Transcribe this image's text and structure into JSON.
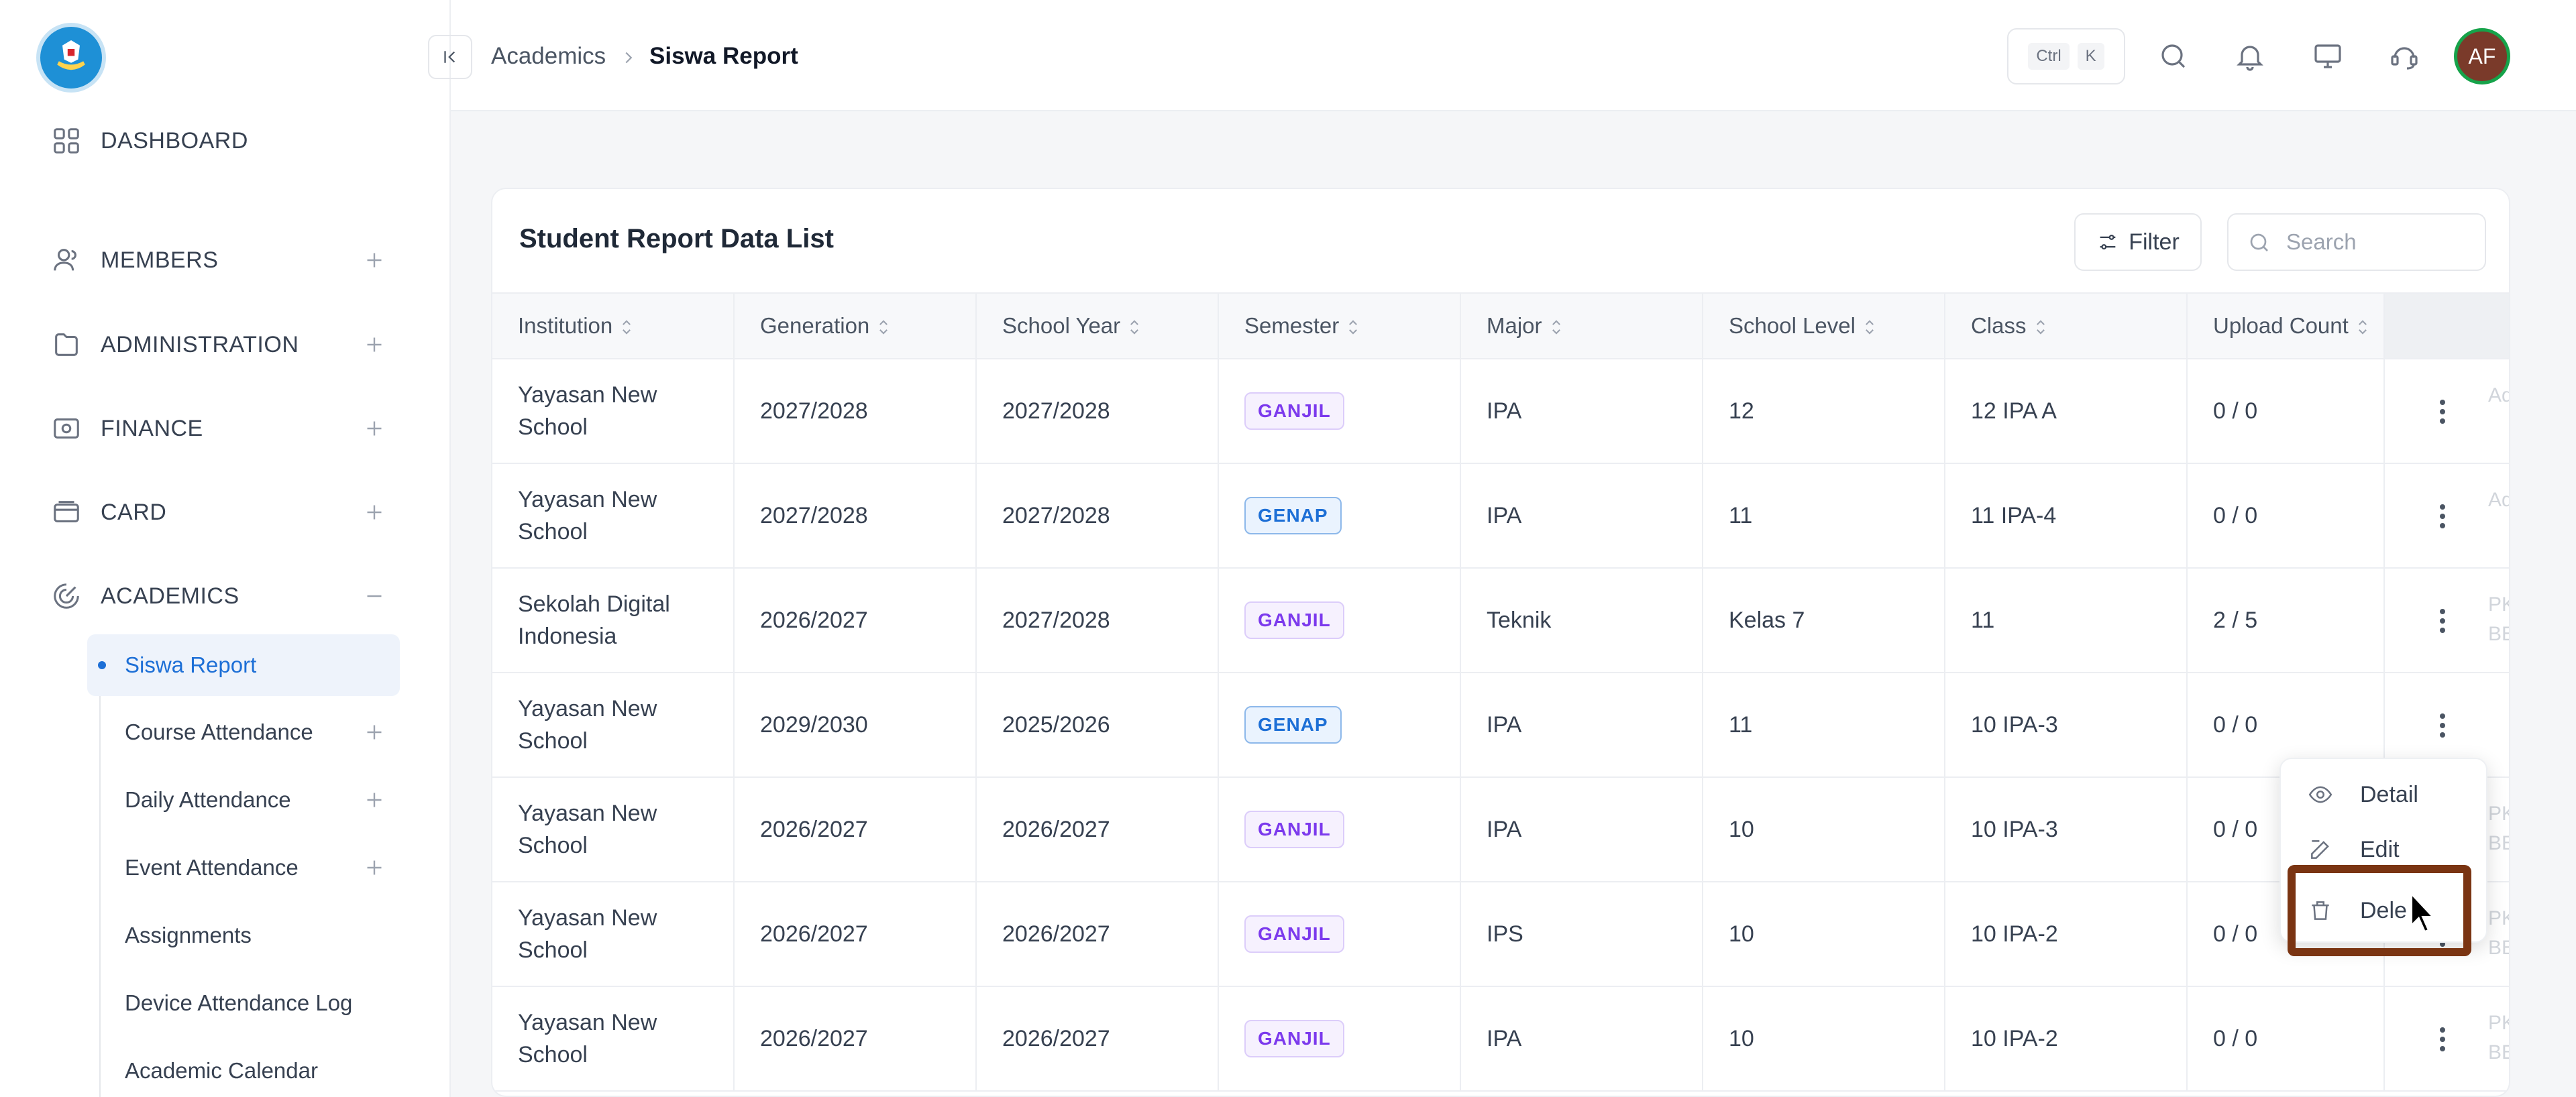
{
  "header": {
    "breadcrumb": [
      "Academics",
      "Siswa Report"
    ],
    "shortcut": [
      "Ctrl",
      "K"
    ],
    "avatar_initials": "AF",
    "icons": [
      "search-icon",
      "bell-icon",
      "monitor-icon",
      "support-icon"
    ]
  },
  "sidebar": {
    "items": [
      {
        "label": "DASHBOARD",
        "icon": "grid-icon",
        "expand": ""
      },
      {
        "label": "MEMBERS",
        "icon": "users-icon",
        "expand": "+"
      },
      {
        "label": "ADMINISTRATION",
        "icon": "folder-icon",
        "expand": "+"
      },
      {
        "label": "FINANCE",
        "icon": "money-icon",
        "expand": "+"
      },
      {
        "label": "CARD",
        "icon": "card-icon",
        "expand": "+"
      },
      {
        "label": "ACADEMICS",
        "icon": "academics-icon",
        "expand": "−"
      }
    ],
    "sub_items": [
      {
        "label": "Siswa Report",
        "active": true
      },
      {
        "label": "Course Attendance",
        "expand": "+"
      },
      {
        "label": "Daily Attendance",
        "expand": "+"
      },
      {
        "label": "Event Attendance",
        "expand": "+"
      },
      {
        "label": "Assignments"
      },
      {
        "label": "Device Attendance Log"
      },
      {
        "label": "Academic Calendar"
      }
    ]
  },
  "card": {
    "title": "Student Report Data List",
    "filter_label": "Filter",
    "search_placeholder": "Search"
  },
  "table": {
    "columns": [
      "Institution",
      "Generation",
      "School Year",
      "Semester",
      "Major",
      "School Level",
      "Class",
      "Upload Count"
    ],
    "rows": [
      {
        "institution": [
          "Yayasan New",
          "School"
        ],
        "generation": "2027/2028",
        "school_year": "2027/2028",
        "semester": "GANJIL",
        "major": "IPA",
        "level": "12",
        "class": "12 IPA A",
        "upload": "0 / 0",
        "extra": [
          "Admi",
          ""
        ]
      },
      {
        "institution": [
          "Yayasan New",
          "School"
        ],
        "generation": "2027/2028",
        "school_year": "2027/2028",
        "semester": "GENAP",
        "major": "IPA",
        "level": "11",
        "class": "11 IPA-4",
        "upload": "0 / 0",
        "extra": [
          "Admi",
          ""
        ]
      },
      {
        "institution": [
          "Sekolah Digital",
          "Indonesia"
        ],
        "generation": "2026/2027",
        "school_year": "2027/2028",
        "semester": "GANJIL",
        "major": "Teknik",
        "level": "Kelas 7",
        "class": "11",
        "upload": "2 / 5",
        "extra": [
          "PKL K",
          "BESA"
        ]
      },
      {
        "institution": [
          "Yayasan New",
          "School"
        ],
        "generation": "2029/2030",
        "school_year": "2025/2026",
        "semester": "GENAP",
        "major": "IPA",
        "level": "11",
        "class": "10 IPA-3",
        "upload": "0 / 0",
        "extra": [
          "",
          ""
        ]
      },
      {
        "institution": [
          "Yayasan New",
          "School"
        ],
        "generation": "2026/2027",
        "school_year": "2026/2027",
        "semester": "GANJIL",
        "major": "IPA",
        "level": "10",
        "class": "10 IPA-3",
        "upload": "0 / 0",
        "extra": [
          "PKL K",
          "BESA"
        ]
      },
      {
        "institution": [
          "Yayasan New",
          "School"
        ],
        "generation": "2026/2027",
        "school_year": "2026/2027",
        "semester": "GANJIL",
        "major": "IPS",
        "level": "10",
        "class": "10 IPA-2",
        "upload": "0 / 0",
        "extra": [
          "PKL K",
          "BESA"
        ]
      },
      {
        "institution": [
          "Yayasan New",
          "School"
        ],
        "generation": "2026/2027",
        "school_year": "2026/2027",
        "semester": "GANJIL",
        "major": "IPA",
        "level": "10",
        "class": "10 IPA-2",
        "upload": "0 / 0",
        "extra": [
          "PKL K",
          "BESA"
        ]
      }
    ]
  },
  "row_menu": {
    "items": [
      {
        "label": "Detail",
        "icon": "eye-icon"
      },
      {
        "label": "Edit",
        "icon": "edit-icon"
      },
      {
        "label": "Dele",
        "icon": "trash-icon"
      }
    ]
  },
  "colors": {
    "accent": "#1d6fd6",
    "ganjil_text": "#7c3aed",
    "ganjil_bg": "#f6f1fe",
    "genap_text": "#1d6fd6",
    "genap_bg": "#eaf3fe",
    "highlight_border": "#7a3412"
  }
}
